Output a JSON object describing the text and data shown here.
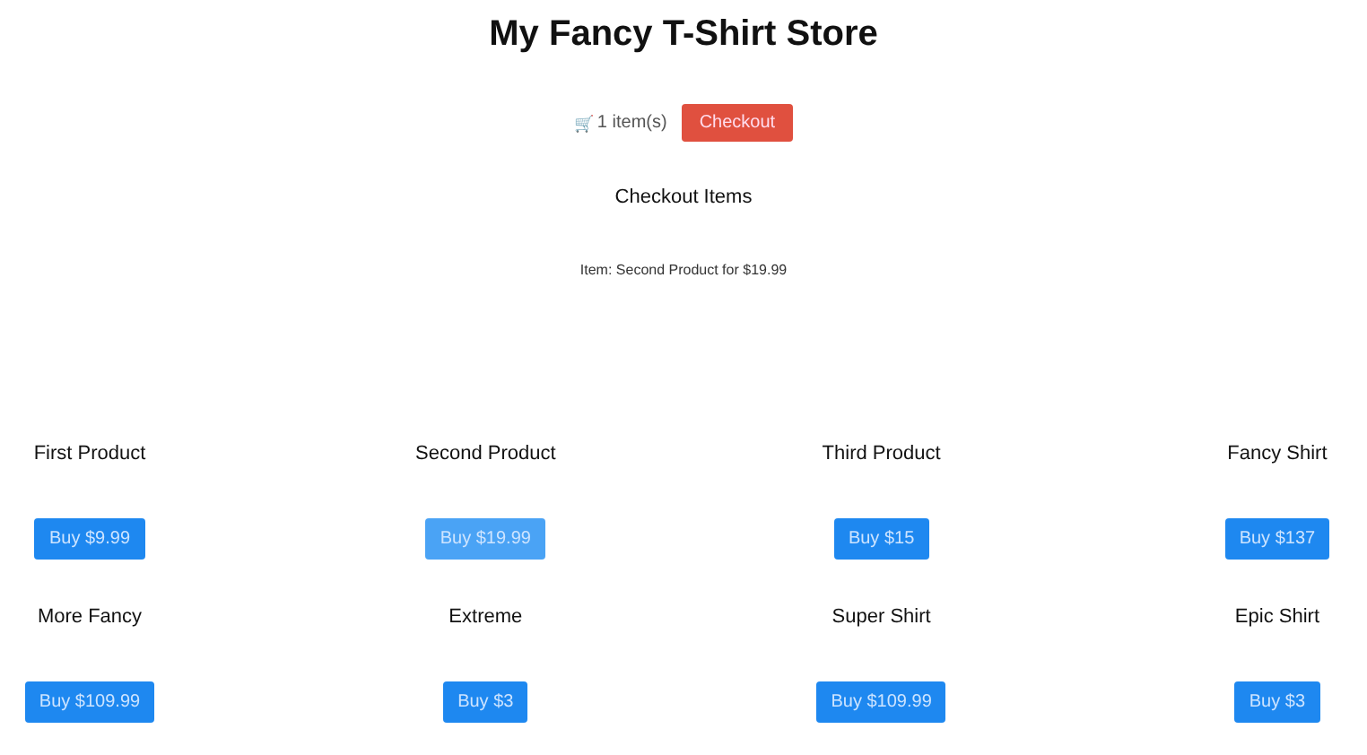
{
  "title": "My Fancy T-Shirt Store",
  "cart": {
    "icon": "🛒",
    "count": "1 item(s)",
    "checkout_button": "Checkout"
  },
  "checkout": {
    "heading": "Checkout Items",
    "items": [
      "Item: Second Product for $19.99"
    ]
  },
  "products": [
    {
      "name": "First Product",
      "button": "Buy $9.99",
      "in_cart": false
    },
    {
      "name": "Second Product",
      "button": "Buy $19.99",
      "in_cart": true
    },
    {
      "name": "Third Product",
      "button": "Buy $15",
      "in_cart": false
    },
    {
      "name": "Fancy Shirt",
      "button": "Buy $137",
      "in_cart": false
    },
    {
      "name": "More Fancy",
      "button": "Buy $109.99",
      "in_cart": false
    },
    {
      "name": "Extreme",
      "button": "Buy $3",
      "in_cart": false
    },
    {
      "name": "Super Shirt",
      "button": "Buy $109.99",
      "in_cart": false
    },
    {
      "name": "Epic Shirt",
      "button": "Buy $3",
      "in_cart": false
    }
  ]
}
